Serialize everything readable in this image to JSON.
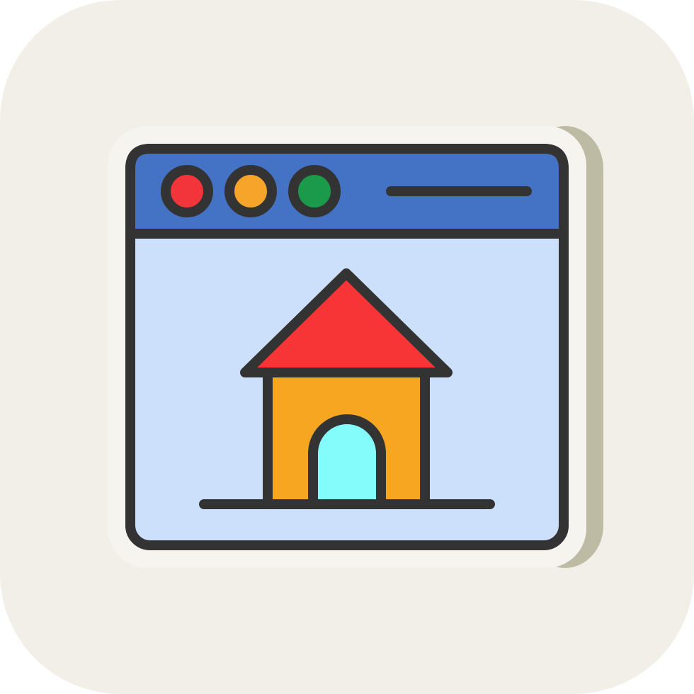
{
  "icon": {
    "name": "home-webpage-icon",
    "style": "filled-line"
  },
  "colors": {
    "tile_background": "#F1EFE7",
    "sticker_background": "#F6F4EE",
    "sticker_shadow": "#BEBBA4",
    "outline": "#333333",
    "title_bar": "#4472C4",
    "window_body": "#CCE0FB",
    "dot_red": "#F1353A",
    "dot_orange": "#F7A42A",
    "dot_green": "#1A9A4A",
    "roof": "#F73436",
    "house_wall": "#F7A622",
    "door": "#84FCFC"
  },
  "window_controls": [
    "close-dot",
    "minimize-dot",
    "maximize-dot"
  ]
}
